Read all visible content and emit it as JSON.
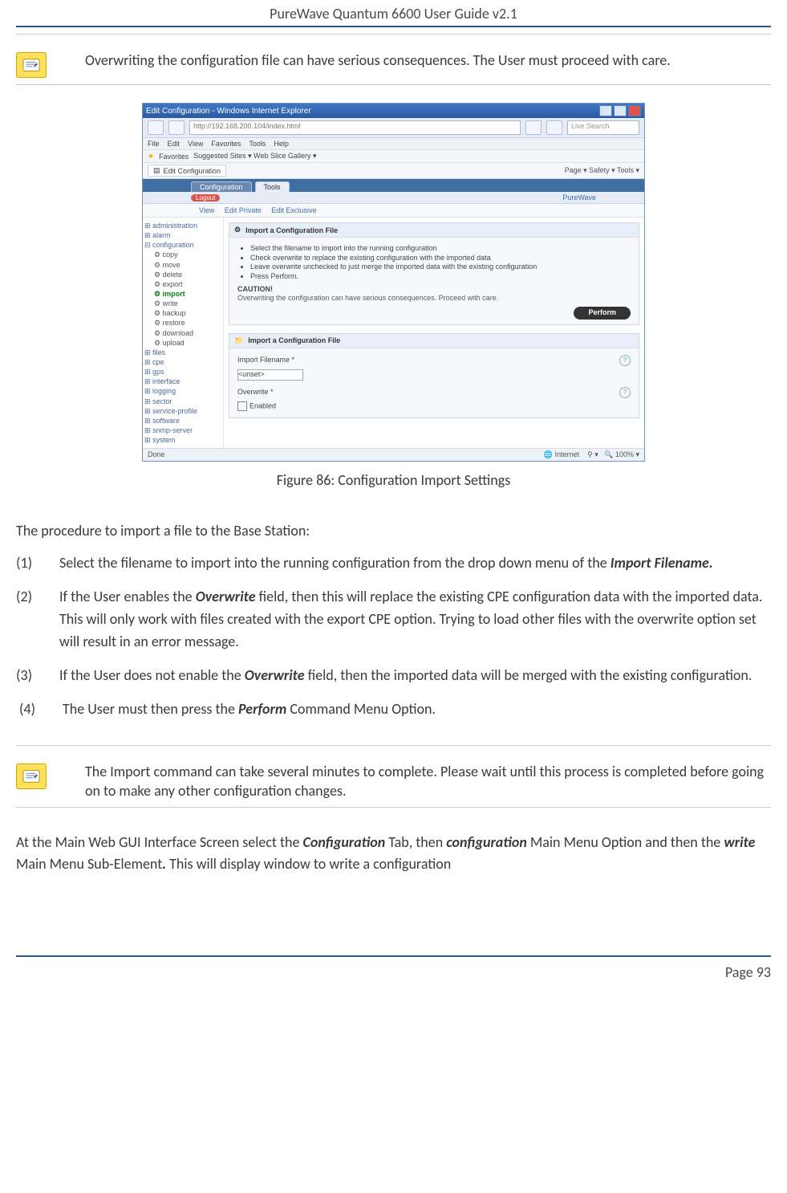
{
  "header": {
    "title": "PureWave Quantum 6600 User Guide v2.1"
  },
  "note1": {
    "text": "Overwriting the configuration file can have serious consequences. The User must proceed with care."
  },
  "screenshot": {
    "title": "Edit Configuration - Windows Internet Explorer",
    "url": "http://192.168.200.104/index.html",
    "search_placeholder": "Live Search",
    "menus": [
      "File",
      "Edit",
      "View",
      "Favorites",
      "Tools",
      "Help"
    ],
    "favorites_label": "Favorites",
    "fav_links": "Suggested Sites ▾   Web Slice Gallery ▾",
    "tab_label": "Edit Configuration",
    "toolbar_right": "Page ▾  Safety ▾  Tools ▾",
    "tabs_strip": {
      "left": "Configuration",
      "mid": "Tools",
      "logout": "Logout",
      "right": "PureWave"
    },
    "viewbar": {
      "view": "View",
      "edit_private": "Edit Private",
      "edit_exclusive": "Edit Exclusive"
    },
    "tree": {
      "items": [
        "administration",
        "alarm",
        "configuration"
      ],
      "children": [
        "copy",
        "move",
        "delete",
        "export",
        "import",
        "write",
        "backup",
        "restore",
        "download",
        "upload"
      ],
      "below": [
        "files",
        "cpe",
        "gps",
        "interface",
        "logging",
        "sector",
        "service-profile",
        "software",
        "snmp-server",
        "system"
      ]
    },
    "panel1": {
      "title": "Import a Configuration File",
      "b1": "Select the filename to import into the running configuration",
      "b2": "Check overwrite to replace the existing configuration with the imported data",
      "b3": "Leave overwrite unchecked to just merge the imported data with the existing configuration",
      "b4": "Press Perform.",
      "caution": "CAUTION!",
      "caution_text": "Overwriting the configuration can have serious consequences. Proceed with care.",
      "perform": "Perform"
    },
    "panel2": {
      "title": "Import a Configuration File",
      "field_filename": "Import Filename *",
      "select_value": "<unset>",
      "field_overwrite": "Overwrite *",
      "enabled": "Enabled"
    },
    "status": {
      "done": "Done",
      "internet": "Internet",
      "zoom": "100%"
    }
  },
  "figure_caption": "Figure 86: Configuration Import Settings",
  "intro": "The procedure to import a file to the Base Station:",
  "steps": [
    {
      "num": "(1)",
      "pre": "Select the filename to import into the running configuration from the drop down menu of the ",
      "em": "Import Filename.",
      "post": ""
    },
    {
      "num": "(2)",
      "pre": "If the User enables the ",
      "em": "Overwrite",
      "post": " field, then this will replace the existing CPE configuration data with the imported data. This will only work with files created with the export CPE option. Trying to load other files with the overwrite option set will result in an error message."
    },
    {
      "num": "(3)",
      "pre": "If the User does not enable the ",
      "em": "Overwrite",
      "post": " field, then the imported data will be merged with the existing configuration."
    },
    {
      "num": "(4)",
      "pre": "The User must then press the ",
      "em": "Perform",
      "post": " Command Menu Option."
    }
  ],
  "note2": {
    "text": "The Import command can take several minutes to complete.  Please wait until this process is completed before going on to make any other configuration changes."
  },
  "closing": {
    "p1a": "At the Main Web GUI Interface Screen select the ",
    "p1b": "Configuration",
    "p1c": " Tab, then ",
    "p1d": "configuration",
    "p1e": " Main Menu Option and then the ",
    "p1f": "write",
    "p1g": " Main Menu Sub-Element",
    "p1h": ". ",
    "p1i": "This will display window to write a configuration"
  },
  "footer": {
    "page": "Page 93"
  }
}
